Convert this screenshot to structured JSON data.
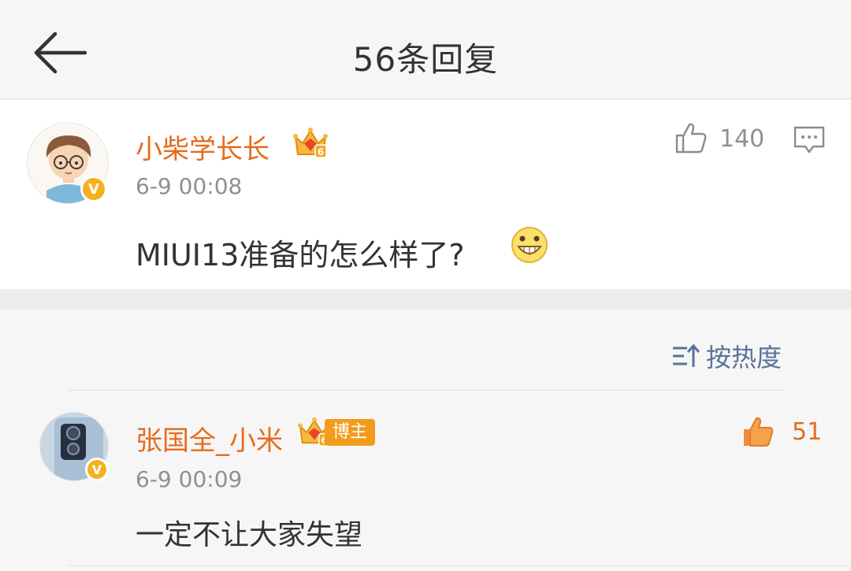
{
  "header": {
    "back_icon": "arrow-left-icon",
    "title": "56条回复"
  },
  "main_comment": {
    "username": "小柴学长长",
    "badge_icon": "crown-icon",
    "verified": "V",
    "time": "6-9 00:08",
    "content": "MIUI13准备的怎么样了?",
    "emoji": "grin-emoji-icon",
    "likes": "140",
    "like_icon": "thumbs-up-outline-icon",
    "reply_icon": "comment-icon"
  },
  "sort": {
    "icon": "sort-icon",
    "label": "按热度"
  },
  "reply": {
    "username": "张国全_小米",
    "badge_icon": "crown-icon",
    "tag": "博主",
    "verified": "V",
    "time": "6-9 00:09",
    "content": "一定不让大家失望",
    "likes": "51",
    "like_icon": "thumbs-up-filled-icon"
  },
  "colors": {
    "username": "#e86b1e",
    "link": "#56739c",
    "badge": "#f3b11e"
  }
}
